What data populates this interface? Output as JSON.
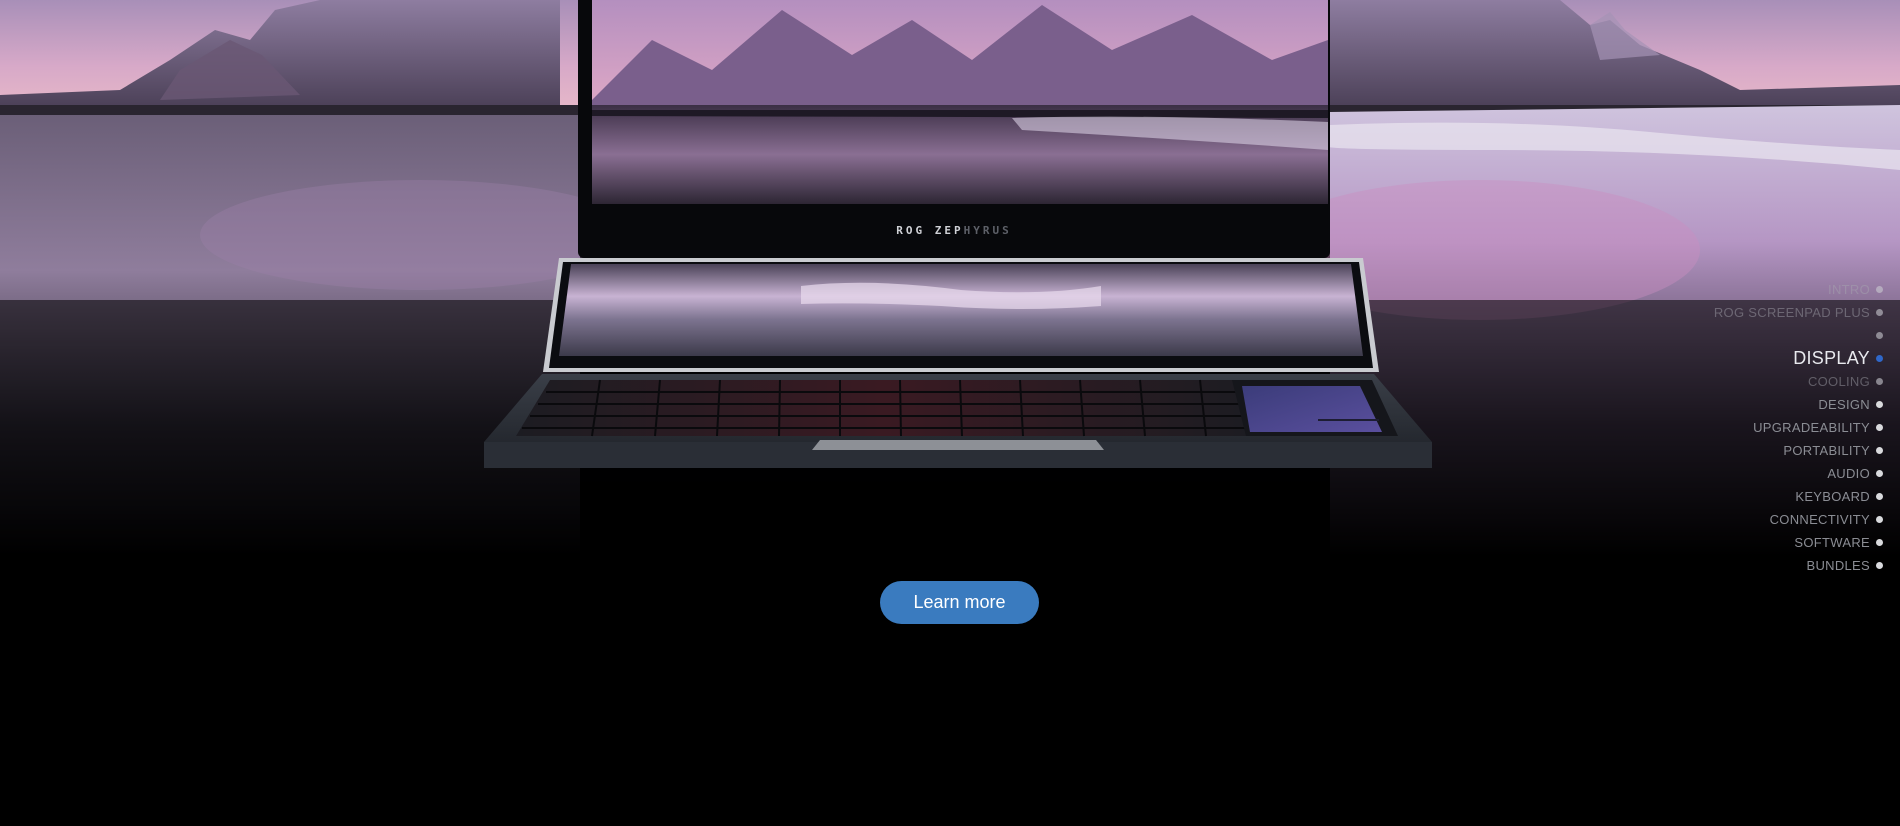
{
  "colors": {
    "accent": "#3a7bbf",
    "active_dot": "#2f67c9",
    "background": "#000000"
  },
  "laptop": {
    "brand_bright": "ROG ZEP",
    "brand_dim": "HYRUS"
  },
  "cta": {
    "learn_more": "Learn more"
  },
  "side_nav": {
    "items": [
      {
        "label": "INTRO",
        "state": "faded"
      },
      {
        "label": "ROG SCREENPAD PLUS",
        "state": "faded"
      },
      {
        "label": "",
        "state": "faded"
      },
      {
        "label": "DISPLAY",
        "state": "active"
      },
      {
        "label": "COOLING",
        "state": "faded"
      },
      {
        "label": "DESIGN",
        "state": "normal"
      },
      {
        "label": "UPGRADEABILITY",
        "state": "normal"
      },
      {
        "label": "PORTABILITY",
        "state": "normal"
      },
      {
        "label": "AUDIO",
        "state": "normal"
      },
      {
        "label": "KEYBOARD",
        "state": "normal"
      },
      {
        "label": "CONNECTIVITY",
        "state": "normal"
      },
      {
        "label": "SOFTWARE",
        "state": "normal"
      },
      {
        "label": "BUNDLES",
        "state": "normal"
      }
    ]
  }
}
